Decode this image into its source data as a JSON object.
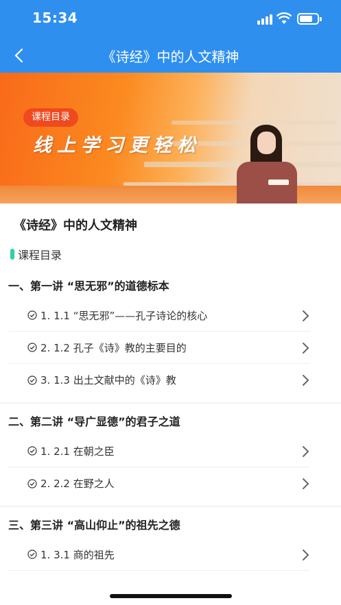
{
  "status_bar": {
    "time": "15:34"
  },
  "nav": {
    "title": "《诗经》中的人文精神"
  },
  "banner": {
    "tag": "课程目录",
    "slogan": "线上学习更轻松"
  },
  "course": {
    "title": "《诗经》中的人文精神"
  },
  "catalog_label": "课程目录",
  "chapters": [
    {
      "title": "一、第一讲 “思无邪”的道德标本",
      "lessons": [
        "1. 1.1 “思无邪”——孔子诗论的核心",
        "2. 1.2 孔子《诗》教的主要目的",
        "3. 1.3 出土文献中的《诗》教"
      ]
    },
    {
      "title": "二、第二讲 “导广显德”的君子之道",
      "lessons": [
        "1. 2.1 在朝之臣",
        "2. 2.2 在野之人"
      ]
    },
    {
      "title": "三、第三讲 “高山仰止”的祖先之德",
      "lessons": [
        "1. 3.1 商的祖先"
      ]
    }
  ],
  "colors": {
    "header": "#2e8fef",
    "accent": "#2cd1a4",
    "tag": "#ef4a1f"
  }
}
